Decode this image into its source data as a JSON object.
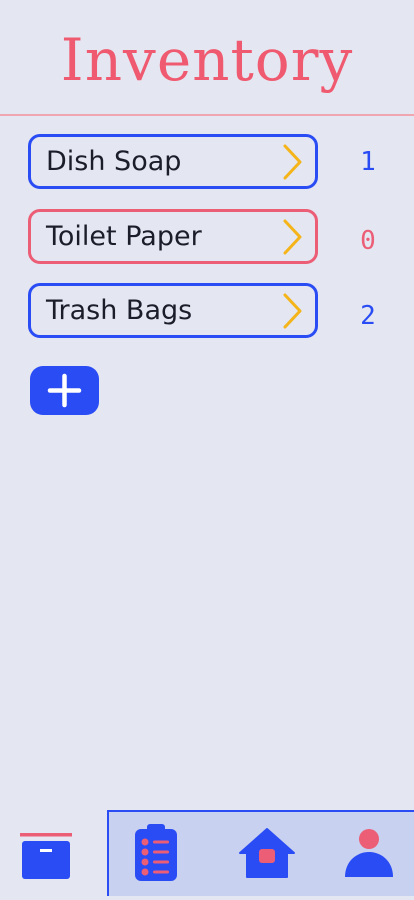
{
  "header": {
    "title": "Inventory"
  },
  "inventory": {
    "items": [
      {
        "label": "Dish Soap",
        "count": "1",
        "status": "in-stock"
      },
      {
        "label": "Toilet Paper",
        "count": "0",
        "status": "out-of-stock"
      },
      {
        "label": "Trash Bags",
        "count": "2",
        "status": "in-stock"
      }
    ]
  },
  "add_button": {
    "icon": "plus-icon"
  },
  "tabbar": {
    "tabs": [
      {
        "icon": "inventory-box-icon",
        "active": true
      },
      {
        "icon": "checklist-icon",
        "active": false
      },
      {
        "icon": "home-icon",
        "active": false
      },
      {
        "icon": "profile-icon",
        "active": false
      }
    ]
  },
  "colors": {
    "background": "#e4e7f1",
    "accent_blue": "#2a4cf5",
    "accent_red": "#ec5d76",
    "chevron_yellow": "#f4b41a",
    "title_red": "#f05a70",
    "tabbar_inactive_bg": "#c8d1ef"
  }
}
